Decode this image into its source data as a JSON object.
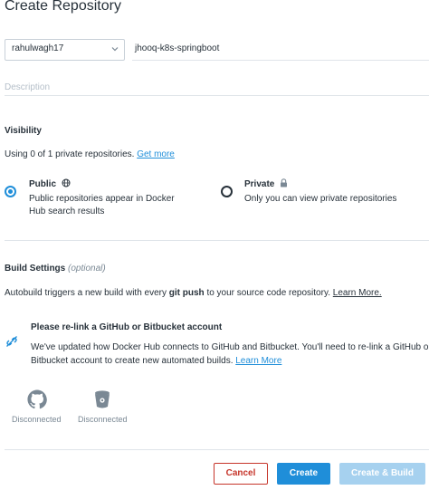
{
  "header": {
    "title": "Create Repository"
  },
  "form": {
    "namespace": "rahulwagh17",
    "repo_name": "jhooq-k8s-springboot",
    "description_placeholder": "Description"
  },
  "visibility": {
    "title": "Visibility",
    "usage_text": "Using 0 of 1 private repositories.",
    "get_more": "Get more",
    "public": {
      "label": "Public",
      "desc_line1": "Public repositories appear in Docker",
      "desc_line2": "Hub search results",
      "selected": true
    },
    "private": {
      "label": "Private",
      "desc": "Only you can view private repositories",
      "selected": false
    }
  },
  "build": {
    "title": "Build Settings",
    "optional": "(optional)",
    "auto_prefix": "Autobuild triggers a new build with every",
    "auto_bold": "git push",
    "auto_suffix": "to your source code repository.",
    "learn_more": "Learn More.",
    "notice_title": "Please re-link a GitHub or Bitbucket account",
    "notice_line1": "We've updated how Docker Hub connects to GitHub and Bitbucket. You'll need to re-link a GitHub or",
    "notice_line2": "Bitbucket account to create new automated builds.",
    "notice_learn_more": "Learn More",
    "providers": [
      {
        "icon": "github-icon",
        "status": "Disconnected"
      },
      {
        "icon": "bitbucket-icon",
        "status": "Disconnected"
      }
    ]
  },
  "actions": {
    "cancel": "Cancel",
    "create": "Create",
    "create_build": "Create & Build"
  },
  "colors": {
    "accent": "#1f8ed9",
    "danger": "#c6352a",
    "disabled": "#a6d1ef",
    "text": "#27313a",
    "muted": "#7a8894"
  }
}
